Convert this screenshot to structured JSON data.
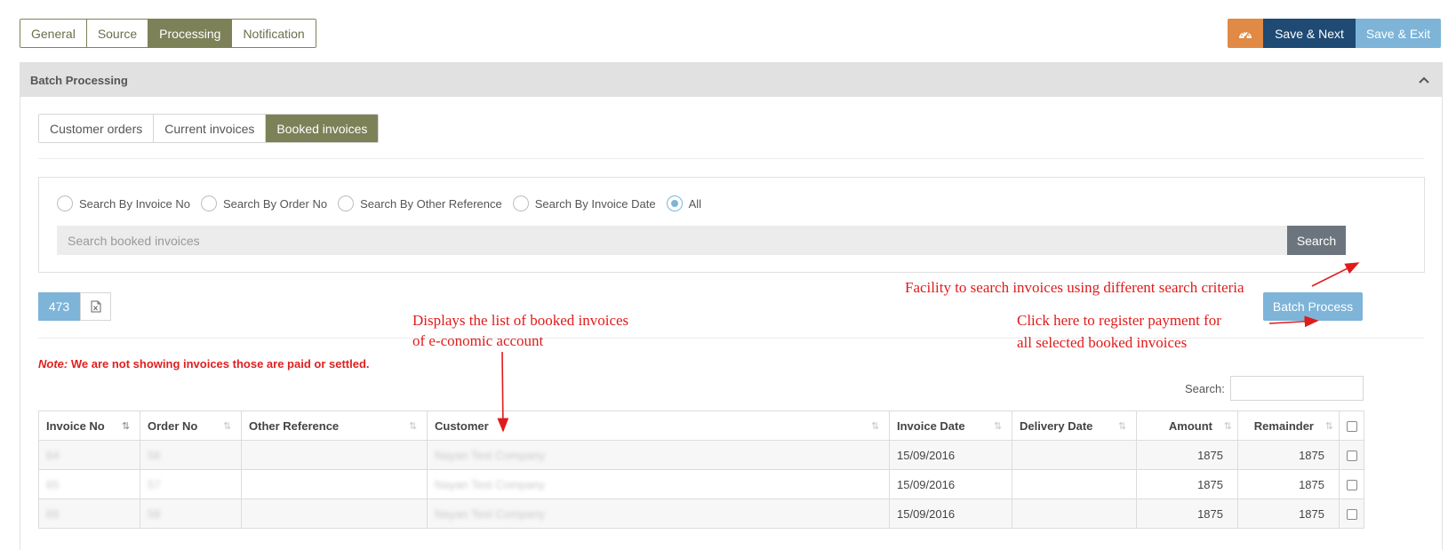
{
  "top_tabs": [
    "General",
    "Source",
    "Processing",
    "Notification"
  ],
  "active_top_tab": "Processing",
  "actions": {
    "dashboard_icon": "speedometer-icon",
    "save_next": "Save & Next",
    "save_exit": "Save & Exit"
  },
  "panel": {
    "title": "Batch Processing",
    "collapse_icon": "chevron-up-icon"
  },
  "sub_tabs": [
    "Customer orders",
    "Current invoices",
    "Booked invoices"
  ],
  "active_sub_tab": "Booked invoices",
  "search": {
    "options": [
      "Search By Invoice No",
      "Search By Order No",
      "Search By Other Reference",
      "Search By Invoice Date",
      "All"
    ],
    "selected": "All",
    "placeholder": "Search booked invoices",
    "button": "Search"
  },
  "count": "473",
  "excel_icon": "excel-icon",
  "batch_button": "Batch Process",
  "note": {
    "label": "Note:",
    "text": " We are not showing invoices those are paid or settled."
  },
  "table_search_label": "Search:",
  "table": {
    "headers": [
      "Invoice No",
      "Order No",
      "Other Reference",
      "Customer",
      "Invoice Date",
      "Delivery Date",
      "Amount",
      "Remainder"
    ],
    "rows": [
      {
        "invoice_no": "64",
        "order_no": "56",
        "other_ref": "",
        "customer": "Nayan Test Company",
        "invoice_date": "15/09/2016",
        "delivery_date": "",
        "amount": "1875",
        "remainder": "1875"
      },
      {
        "invoice_no": "65",
        "order_no": "57",
        "other_ref": "",
        "customer": "Nayan Test Company",
        "invoice_date": "15/09/2016",
        "delivery_date": "",
        "amount": "1875",
        "remainder": "1875"
      },
      {
        "invoice_no": "66",
        "order_no": "58",
        "other_ref": "",
        "customer": "Nayan Test Company",
        "invoice_date": "15/09/2016",
        "delivery_date": "",
        "amount": "1875",
        "remainder": "1875"
      }
    ]
  },
  "annotations": {
    "search_facility": "Facility to search invoices using different search criteria",
    "list_line1": "Displays the list of booked invoices",
    "list_line2": "of e-conomic account",
    "register_line1": "Click here to register payment for",
    "register_line2": "all selected booked invoices"
  },
  "colors": {
    "olive": "#7d8158",
    "navy": "#1e4a74",
    "light_blue": "#7db4d8",
    "orange": "#e08a45",
    "annotation_red": "#e01b1b"
  }
}
